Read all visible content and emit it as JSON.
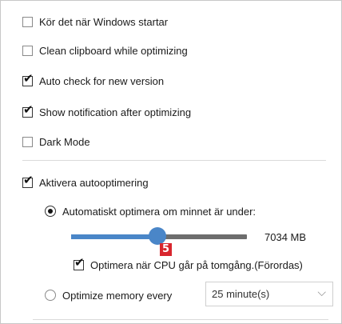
{
  "options": {
    "run_on_startup": {
      "label": "Kör det när Windows startar",
      "checked": false
    },
    "clean_clipboard": {
      "label": "Clean clipboard while optimizing",
      "checked": false
    },
    "auto_check_version": {
      "label": "Auto check for new version",
      "checked": true
    },
    "show_notification": {
      "label": "Show notification after optimizing",
      "checked": true
    },
    "dark_mode": {
      "label": "Dark Mode",
      "checked": false
    }
  },
  "auto_optimize": {
    "label": "Aktivera autooptimering",
    "checked": true,
    "threshold_radio": {
      "label": "Automatiskt optimera om minnet är under:",
      "selected": true
    },
    "slider": {
      "value_label": "7034 MB",
      "fraction": 0.49
    },
    "badge": "5",
    "cpu_idle": {
      "label": "Optimera när CPU går på tomgång.(Förordas)",
      "checked": true
    },
    "interval_radio": {
      "label": "Optimize memory every",
      "selected": false
    },
    "interval_select": {
      "value": "25 minute(s)"
    }
  },
  "icons": {
    "checkmark": "checkmark-icon",
    "chevron": "chevron-down-icon"
  }
}
